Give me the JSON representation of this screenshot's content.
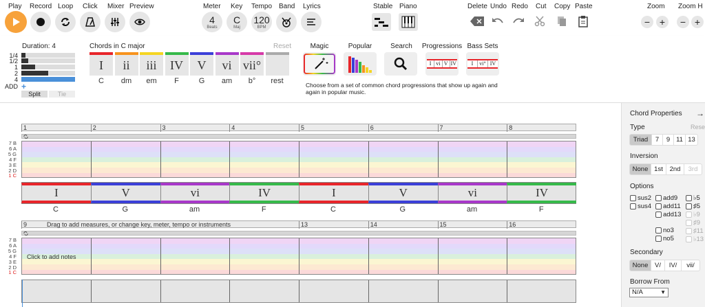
{
  "toolbar": {
    "play": "Play",
    "record": "Record",
    "loop": "Loop",
    "click": "Click",
    "mixer": "Mixer",
    "preview": "Preview",
    "meter": "Meter",
    "key": "Key",
    "tempo": "Tempo",
    "band": "Band",
    "lyrics": "Lyrics",
    "stable": "Stable",
    "piano": "Piano",
    "delete": "Delete",
    "undo": "Undo",
    "redo": "Redo",
    "cut": "Cut",
    "copy": "Copy",
    "paste": "Paste",
    "zoom": "Zoom",
    "zoom_h": "Zoom H",
    "meter_value": "4",
    "meter_sub": "Beats",
    "key_value": "C",
    "key_sub": "Maj",
    "tempo_value": "120",
    "tempo_sub": "BPM",
    "zoom_minus": "−",
    "zoom_plus": "+",
    "accent_color": "#f7a23b"
  },
  "duration": {
    "title": "Duration: 4",
    "labels": [
      "1/4",
      "1/2",
      "1",
      "2",
      "4",
      "ADD"
    ],
    "split": "Split",
    "tie": "Tie"
  },
  "chords_panel": {
    "title": "Chords in C major",
    "reset": "Reset",
    "chords": [
      {
        "numeral": "I",
        "name": "C",
        "color": "#e8252a"
      },
      {
        "numeral": "ii",
        "name": "dm",
        "color": "#f7931e"
      },
      {
        "numeral": "iii",
        "name": "em",
        "color": "#f5d522"
      },
      {
        "numeral": "IV",
        "name": "F",
        "color": "#36b94a"
      },
      {
        "numeral": "V",
        "name": "G",
        "color": "#3b3fd8"
      },
      {
        "numeral": "vi",
        "name": "am",
        "color": "#a838c9"
      },
      {
        "numeral": "vii°",
        "name": "b°",
        "color": "#d63aa8"
      },
      {
        "numeral": "",
        "name": "rest",
        "color": "#aaaaaa"
      }
    ]
  },
  "features": {
    "magic": "Magic",
    "popular": "Popular",
    "search": "Search",
    "progressions": "Progressions",
    "bass_sets": "Bass Sets",
    "description": "Choose from a set of common chord progressions that show up again and again in popular music.",
    "prog_numerals": [
      "I",
      "vi",
      "V",
      "IV"
    ],
    "bass_numerals": [
      "I",
      "vi°",
      "IV"
    ]
  },
  "sheet": {
    "row1_measures": [
      "1",
      "2",
      "3",
      "4",
      "5",
      "6",
      "7",
      "8"
    ],
    "row2_measures": [
      "9",
      "13",
      "14",
      "15",
      "16"
    ],
    "drag_hint": "Drag to add measures, or change key, meter, tempo or instruments",
    "click_hint": "Click to add notes",
    "note_labels": [
      "7 B",
      "6 A",
      "5 G",
      "4 F",
      "3 E",
      "2 D",
      "1 C"
    ],
    "progression": [
      {
        "numeral": "I",
        "name": "C",
        "color": "#e8252a"
      },
      {
        "numeral": "V",
        "name": "G",
        "color": "#3b3fd8"
      },
      {
        "numeral": "vi",
        "name": "am",
        "color": "#a838c9"
      },
      {
        "numeral": "IV",
        "name": "F",
        "color": "#36b94a"
      },
      {
        "numeral": "I",
        "name": "C",
        "color": "#e8252a"
      },
      {
        "numeral": "V",
        "name": "G",
        "color": "#3b3fd8"
      },
      {
        "numeral": "vi",
        "name": "am",
        "color": "#a838c9"
      },
      {
        "numeral": "IV",
        "name": "F",
        "color": "#36b94a"
      }
    ]
  },
  "sidebar": {
    "title": "Chord Properties",
    "type_label": "Type",
    "reset": "Reset",
    "types": [
      "Triad",
      "7",
      "9",
      "11",
      "13"
    ],
    "inversion_label": "Inversion",
    "inversions": [
      "None",
      "1st",
      "2nd",
      "3rd"
    ],
    "options_label": "Options",
    "opt_sus2": "sus2",
    "opt_sus4": "sus4",
    "opt_add9": "add9",
    "opt_add11": "add11",
    "opt_add13": "add13",
    "opt_no3": "no3",
    "opt_no5": "no5",
    "opt_flat5": "♭5",
    "opt_sharp5": "♯5",
    "opt_flat9": "♭9",
    "opt_sharp9": "♯9",
    "opt_sharp11": "♯11",
    "opt_flat13": "♭13",
    "secondary_label": "Secondary",
    "secondary": [
      "None",
      "V/",
      "IV/",
      "vii/"
    ],
    "borrow_label": "Borrow From",
    "borrow_value": "N/A"
  }
}
